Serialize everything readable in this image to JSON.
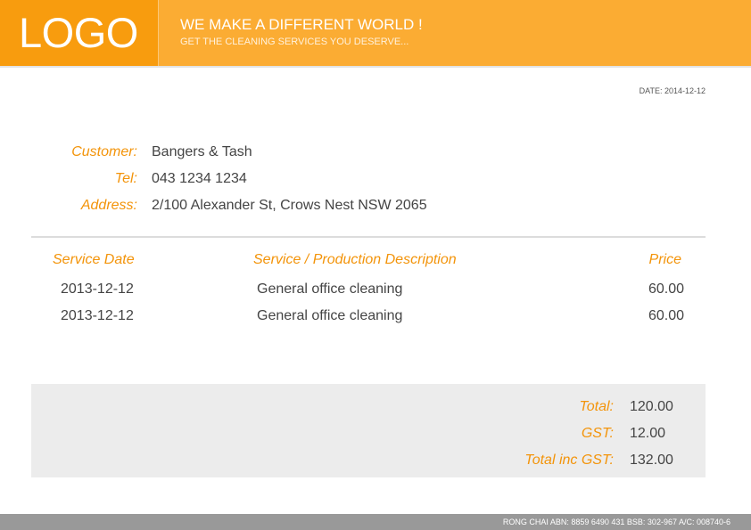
{
  "header": {
    "logo": "LOGO",
    "slogan": "WE MAKE A DIFFERENT WORLD !",
    "subslogan": "GET THE CLEANING SERVICES YOU DESERVE..."
  },
  "date": "DATE: 2014-12-12",
  "customer": {
    "customer_label": "Customer:",
    "customer_value": "Bangers & Tash",
    "tel_label": "Tel:",
    "tel_value": "043 1234 1234",
    "address_label": "Address:",
    "address_value": "2/100 Alexander St, Crows Nest NSW 2065"
  },
  "table": {
    "headers": [
      "Service Date",
      "Service / Production Description",
      "Price"
    ],
    "rows": [
      {
        "date": "2013-12-12",
        "description": "General office cleaning",
        "price": "60.00"
      },
      {
        "date": "2013-12-12",
        "description": "General office cleaning",
        "price": "60.00"
      }
    ]
  },
  "totals": {
    "total_label": "Total:",
    "total_value": "120.00",
    "gst_label": "GST:",
    "gst_value": "12.00",
    "total_inc_label": "Total inc GST:",
    "total_inc_value": "132.00"
  },
  "footer": "RONG CHAI ABN: 8859 6490 431 BSB: 302-967 A/C: 008740-6",
  "colors": {
    "header_orange": "#fbac33",
    "logo_orange": "#f89c0e",
    "label_orange": "#f3940a",
    "totals_bg": "#ececec",
    "footer_gray": "#999999"
  }
}
